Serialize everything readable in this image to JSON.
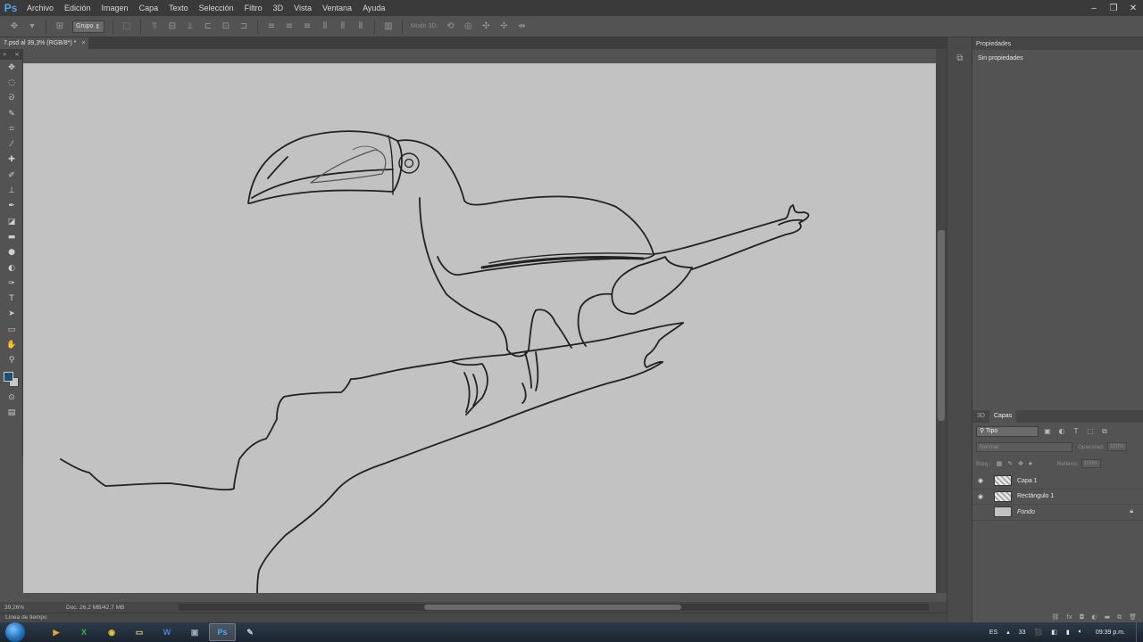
{
  "app": {
    "logo": "Ps"
  },
  "menu": [
    "Archivo",
    "Edición",
    "Imagen",
    "Capa",
    "Texto",
    "Selección",
    "Filtro",
    "3D",
    "Vista",
    "Ventana",
    "Ayuda"
  ],
  "window_controls": {
    "minimize": "‒",
    "restore": "❐",
    "close": "✕"
  },
  "options_bar": {
    "group_select": "Grupo",
    "mode_3d": "Modo 3D:"
  },
  "document": {
    "tab_title": "7.psd al 39,3% (RGB/8*) *",
    "close": "×"
  },
  "status": {
    "zoom": "39,26%",
    "doc_info": "Doc: 26,2 MB/42,7 MB"
  },
  "timeline_label": "Línea de tiempo",
  "properties": {
    "tab": "Propiedades",
    "message": "Sin propiedades"
  },
  "layers_panel": {
    "tabs": [
      "3D",
      "Capas"
    ],
    "filter": "Tipo",
    "blend_mode": "Normal",
    "opacity_label": "Opacidad:",
    "opacity_value": "100%",
    "lock_label": "Bloq.:",
    "fill_label": "Relleno:",
    "fill_value": "100%",
    "layers": [
      {
        "name": "Capa 1",
        "visible": true
      },
      {
        "name": "Rectángulo 1",
        "visible": true
      },
      {
        "name": "Fondo",
        "visible": false,
        "locked": true
      }
    ]
  },
  "taskbar": {
    "apps": [
      "media-player",
      "excel",
      "chrome",
      "explorer",
      "word",
      "window-manager",
      "photoshop",
      "paint"
    ],
    "app_labels": {
      "excel": "X",
      "word": "W",
      "photoshop": "Ps"
    },
    "language": "ES",
    "tray_number": "33",
    "clock": "09:39 p.m."
  },
  "colors": {
    "foreground": "#1c4f73",
    "background": "#c8c8c8",
    "canvas": "#c2c2c2",
    "chrome": "#535353"
  }
}
